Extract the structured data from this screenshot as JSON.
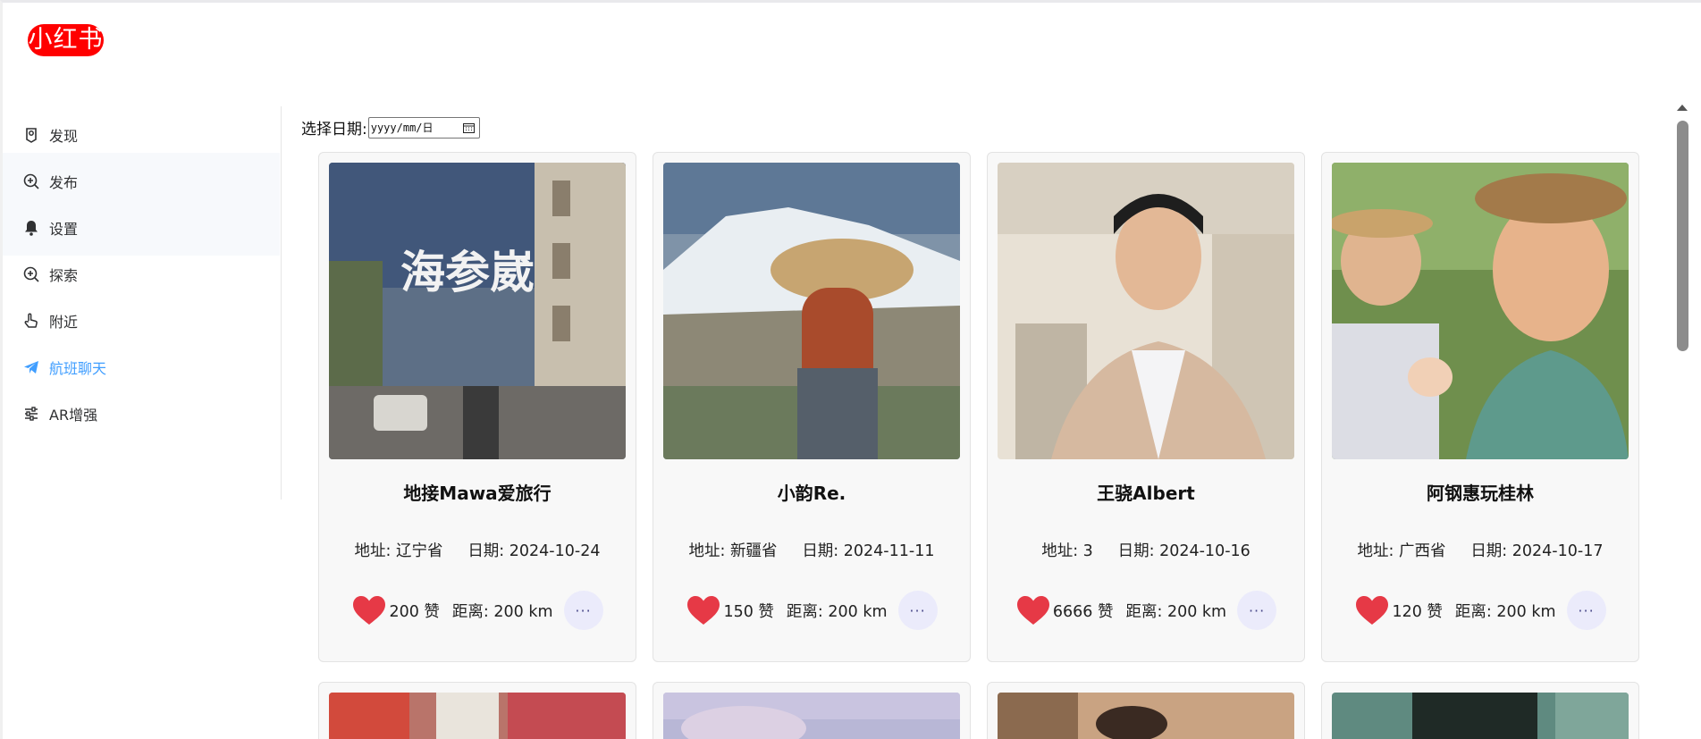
{
  "logo": {
    "text": "小红书"
  },
  "sidebar": {
    "items": [
      {
        "label": "发现",
        "icon": "discover-icon"
      },
      {
        "label": "发布",
        "icon": "publish-icon"
      },
      {
        "label": "设置",
        "icon": "bell-icon"
      },
      {
        "label": "探索",
        "icon": "explore-icon"
      },
      {
        "label": "附近",
        "icon": "hand-pointer-icon"
      },
      {
        "label": "航班聊天",
        "icon": "paper-plane-icon"
      },
      {
        "label": "AR增强",
        "icon": "sliders-icon"
      }
    ],
    "active_index": 5,
    "accent_color": "#409eff"
  },
  "date_filter": {
    "label": "选择日期:",
    "placeholder": "yyyy/mm/日"
  },
  "cards": [
    {
      "name": "地接Mawa爱旅行",
      "address": "地址: 辽宁省",
      "date": "日期: 2024-10-24",
      "likes": "200 赞",
      "distance": "距离: 200 km"
    },
    {
      "name": "小韵Re.",
      "address": "地址: 新疆省",
      "date": "日期: 2024-11-11",
      "likes": "150 赞",
      "distance": "距离: 200 km"
    },
    {
      "name": "王骁Albert",
      "address": "地址: 3",
      "date": "日期: 2024-10-16",
      "likes": "6666 赞",
      "distance": "距离: 200 km"
    },
    {
      "name": "阿钢惠玩桂林",
      "address": "地址: 广西省",
      "date": "日期: 2024-10-17",
      "likes": "120 赞",
      "distance": "距离: 200 km"
    }
  ],
  "photo_overlay_text": "海参崴",
  "more_label": "···",
  "colors": {
    "logo_red": "#ff0000",
    "heart_red": "#e63946",
    "more_bg": "#ebebfb"
  }
}
